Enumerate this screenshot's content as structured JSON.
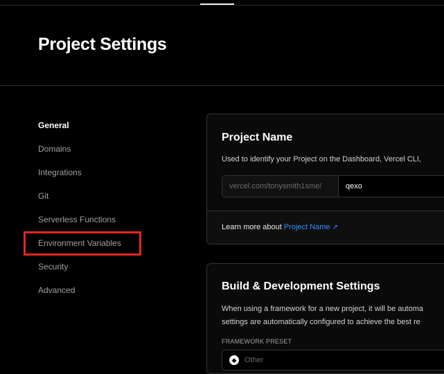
{
  "page": {
    "title": "Project Settings"
  },
  "sidebar": {
    "items": [
      {
        "label": "General"
      },
      {
        "label": "Domains"
      },
      {
        "label": "Integrations"
      },
      {
        "label": "Git"
      },
      {
        "label": "Serverless Functions"
      },
      {
        "label": "Environment Variables"
      },
      {
        "label": "Security"
      },
      {
        "label": "Advanced"
      }
    ],
    "active": "General"
  },
  "project_name_card": {
    "title": "Project Name",
    "description": "Used to identify your Project on the Dashboard, Vercel CLI,",
    "url_prefix": "vercel.com/tonysmith1sme/",
    "value": "qexo",
    "footer_text": "Learn more about ",
    "footer_link": "Project Name",
    "footer_icon": "external-link-icon"
  },
  "build_card": {
    "title": "Build & Development Settings",
    "description_line1": "When using a framework for a new project, it will be automa",
    "description_line2": "settings are automatically configured to achieve the best re",
    "framework_label": "FRAMEWORK PRESET",
    "framework_value": "Other",
    "framework_icon": "framework-icon"
  },
  "colors": {
    "background": "#000000",
    "link": "#3291ff",
    "highlight": "#e5261d"
  }
}
